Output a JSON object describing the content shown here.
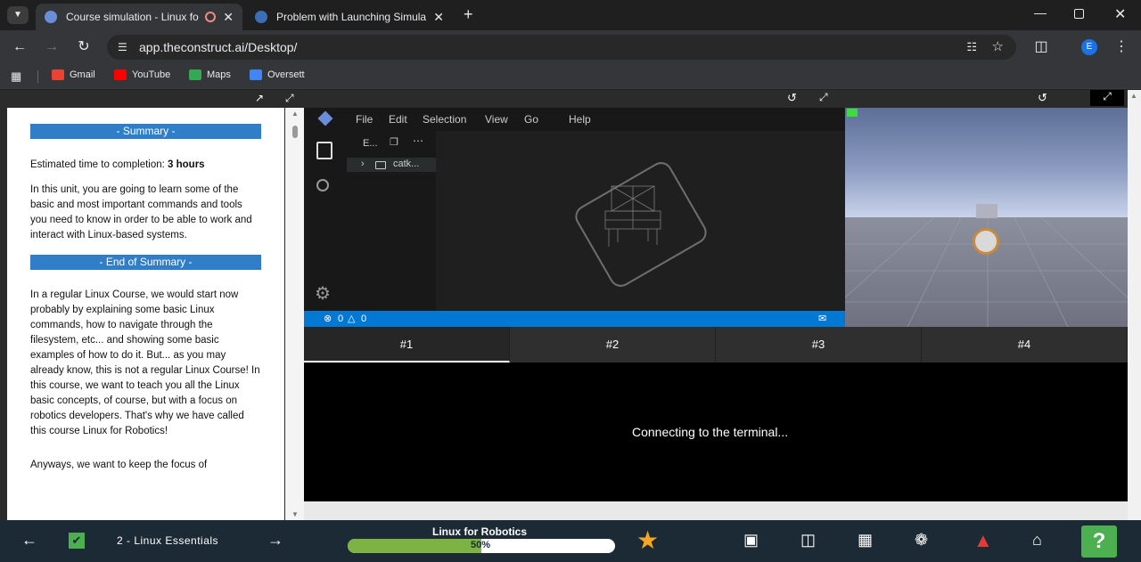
{
  "browser": {
    "tabs": [
      {
        "title": "Course simulation - Linux fo",
        "active": true
      },
      {
        "title": "Problem with Launching Simula",
        "active": false
      }
    ],
    "new_tab": "+",
    "url": "app.theconstruct.ai/Desktop/",
    "profile_initial": "E",
    "bookmarks": [
      "Gmail",
      "YouTube",
      "Maps",
      "Oversett"
    ]
  },
  "notebook": {
    "summary_header": "- Summary -",
    "time_label": "Estimated time to completion:",
    "time_value": "3 hours",
    "para1": "In this unit, you are going to learn some of the basic and most important commands and tools you need to know in order to be able to work and interact with Linux-based systems.",
    "end_header": "- End of Summary -",
    "para2": "In a regular Linux Course, we would start now probably by explaining some basic Linux commands, how to navigate through the filesystem, etc... and showing some basic examples of how to do it. But... as you may already know, this is not a regular Linux Course! In this course, we want to teach you all the Linux basic concepts, of course, but with a focus on robotics developers. That's why we have called this course Linux for Robotics!",
    "para3": "Anyways, we want to keep the focus of"
  },
  "ide": {
    "menu": [
      "File",
      "Edit",
      "Selection",
      "View",
      "Go",
      "Help"
    ],
    "explorer_title": "E...",
    "folder": "catk...",
    "status_errors": "0",
    "status_warnings": "0"
  },
  "terminal": {
    "tabs": [
      "#1",
      "#2",
      "#3",
      "#4"
    ],
    "message": "Connecting to the terminal..."
  },
  "bottom": {
    "unit": "2 - Linux Essentials",
    "course": "Linux for Robotics",
    "progress_label": "50%",
    "progress": 0.5,
    "help": "?"
  },
  "colors": {
    "accent_blue": "#2f7ec7",
    "progress_green": "#7cb342",
    "star": "#f5a623",
    "help_green": "#4caf50",
    "warning_red": "#e53935"
  }
}
